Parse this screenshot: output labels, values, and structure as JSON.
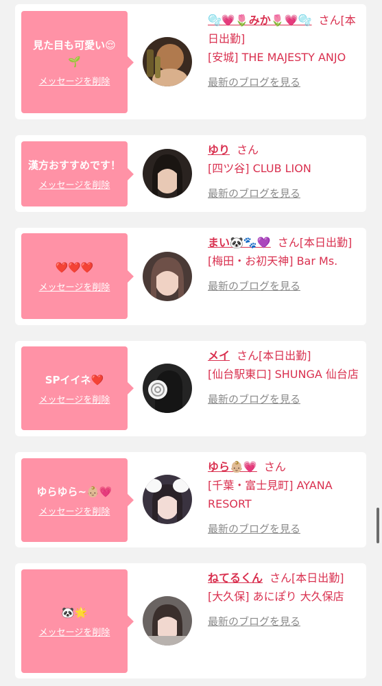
{
  "colors": {
    "page_background": "#f2f2f2",
    "card_background": "#ffffff",
    "bubble_background": "#ff92a6",
    "accent_text": "#d9304f",
    "blog_link": "#8a8a8a"
  },
  "delete_label": "メッセージを削除",
  "blog_label": "最新のブログを見る",
  "entries": [
    {
      "message": "見た目も可愛い😌🌱",
      "name": "🫧💗🌷みか🌷💗🫧",
      "san_status": "さん[本日出勤]",
      "shop": "[安城] THE MAJESTY ANJO"
    },
    {
      "message": "漢方おすすめです！",
      "name": "ゆり",
      "san_status": "さん",
      "shop": "[四ツ谷] CLUB LION"
    },
    {
      "message": "❤️❤️❤️",
      "name": "まい🐼🐾💜",
      "san_status": "さん[本日出勤]",
      "shop": "[梅田・お初天神] Bar Ms."
    },
    {
      "message": "SPイイネ❤️",
      "name": "メイ",
      "san_status": "さん[本日出勤]",
      "shop": "[仙台駅東口] SHUNGA 仙台店"
    },
    {
      "message": "ゆらゆら~👶🏼💗",
      "name": "ゆら👶🏼💗",
      "san_status": "さん",
      "shop": "[千葉・富士見町] AYANA RESORT"
    },
    {
      "message": "🐼🌟",
      "name": "ねてるくん",
      "san_status": "さん[本日出勤]",
      "shop": "[大久保] あにぽり 大久保店"
    }
  ]
}
